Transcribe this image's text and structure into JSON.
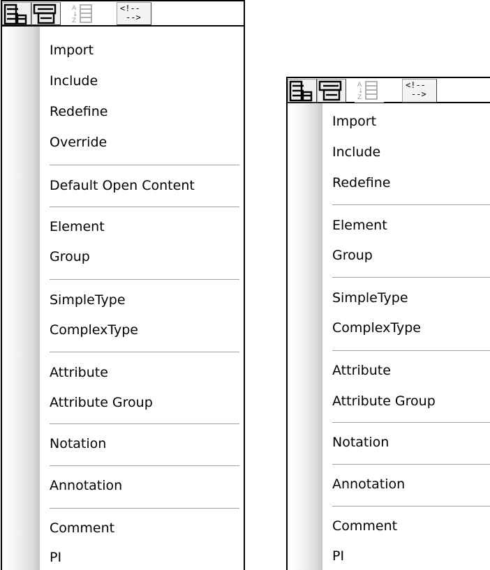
{
  "toolbar": {
    "icons": [
      "collapse-icon",
      "expand-icon",
      "sort-az-icon",
      "comment-toggle-icon"
    ],
    "comment_glyph_top": "<!--",
    "comment_glyph_bottom": "-->"
  },
  "menu_left": {
    "items": [
      {
        "label": "Import"
      },
      {
        "label": "Include"
      },
      {
        "label": "Redefine"
      },
      {
        "label": "Override"
      },
      {
        "label": "Default Open Content"
      },
      {
        "label": "Element"
      },
      {
        "label": "Group"
      },
      {
        "label": "SimpleType"
      },
      {
        "label": "ComplexType"
      },
      {
        "label": "Attribute"
      },
      {
        "label": "Attribute Group"
      },
      {
        "label": "Notation"
      },
      {
        "label": "Annotation"
      },
      {
        "label": "Comment"
      },
      {
        "label": "PI"
      }
    ]
  },
  "menu_right": {
    "items": [
      {
        "label": "Import"
      },
      {
        "label": "Include"
      },
      {
        "label": "Redefine"
      },
      {
        "label": "Element"
      },
      {
        "label": "Group"
      },
      {
        "label": "SimpleType"
      },
      {
        "label": "ComplexType"
      },
      {
        "label": "Attribute"
      },
      {
        "label": "Attribute Group"
      },
      {
        "label": "Notation"
      },
      {
        "label": "Annotation"
      },
      {
        "label": "Comment"
      },
      {
        "label": "PI"
      }
    ]
  }
}
